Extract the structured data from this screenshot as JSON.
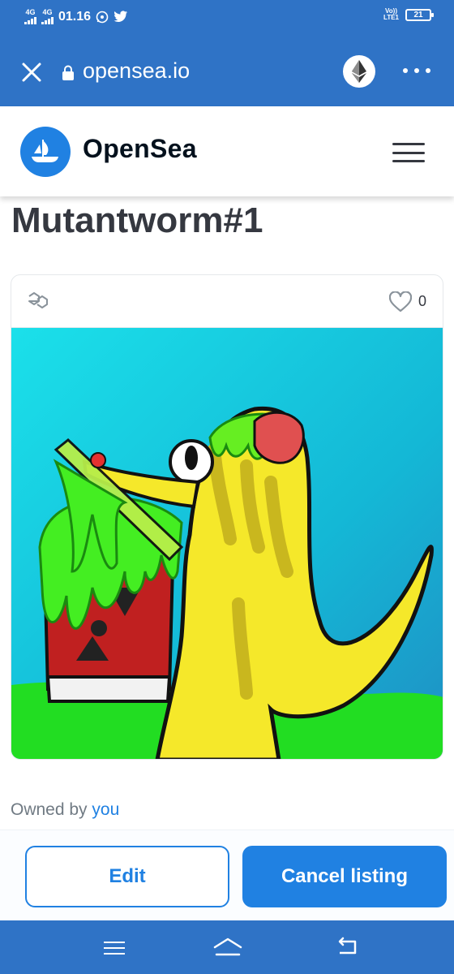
{
  "status_bar": {
    "net1": "4G",
    "net2": "4G",
    "time": "01.16",
    "volte_line1": "Vo))",
    "volte_line2": "LTE1",
    "battery": "21"
  },
  "browser": {
    "url": "opensea.io",
    "icons": [
      "close-icon",
      "lock-icon",
      "ethereum-icon",
      "more-icon"
    ]
  },
  "header": {
    "brand": "OpenSea",
    "brand_color": "#2081e2"
  },
  "asset": {
    "title": "Mutantworm#1",
    "favorites": "0",
    "owned_prefix": "Owned by",
    "owner": "you"
  },
  "actions": {
    "edit_label": "Edit",
    "cancel_label": "Cancel listing"
  },
  "colors": {
    "system_bar": "#2f73c6",
    "accent": "#2081e2",
    "text_dark": "#353840",
    "text_muted": "#707a83"
  }
}
